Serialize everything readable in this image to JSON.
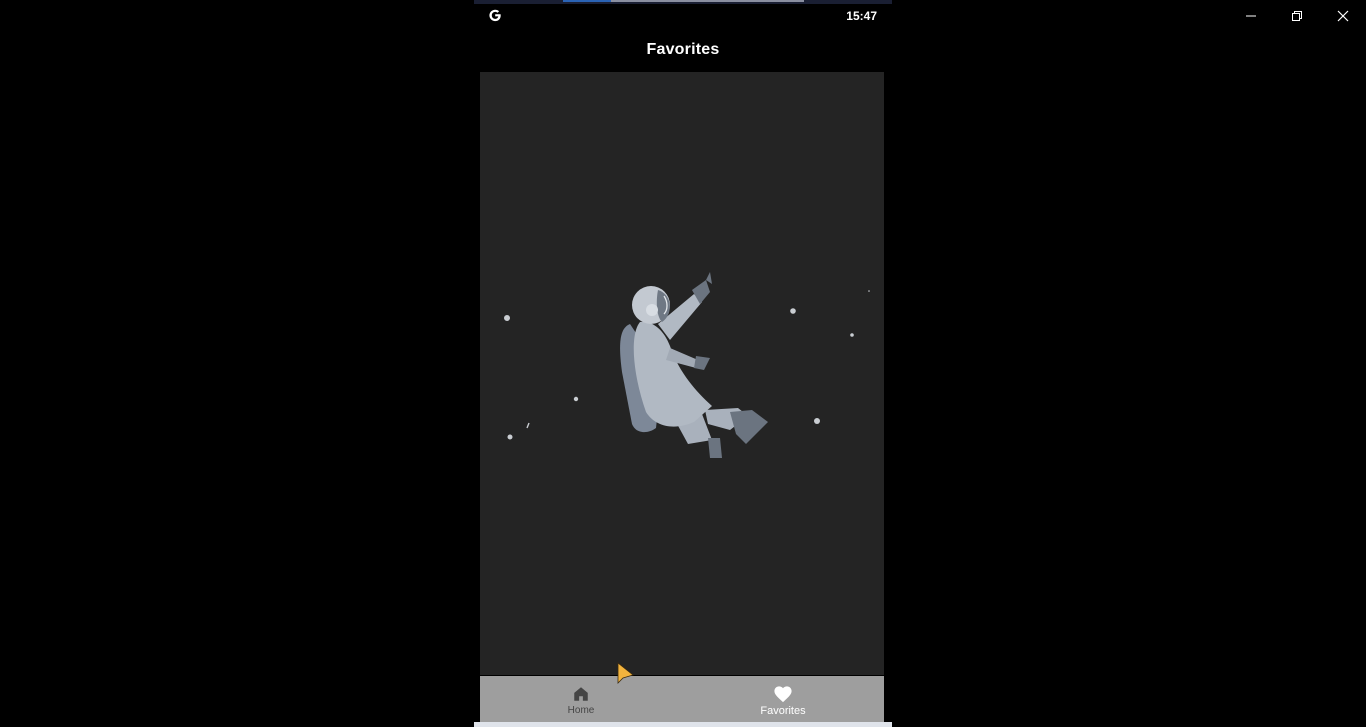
{
  "status": {
    "time": "15:47",
    "app_icon": "google-g-icon"
  },
  "app_bar": {
    "title": "Favorites"
  },
  "illustration": {
    "subject": "floating-astronaut-icon"
  },
  "bottom_nav": {
    "items": [
      {
        "label": "Home",
        "icon": "home-icon",
        "active": false
      },
      {
        "label": "Favorites",
        "icon": "heart-icon",
        "active": true
      }
    ]
  },
  "window_controls": {
    "minimize": "minimize-icon",
    "restore": "restore-icon",
    "close": "close-icon"
  },
  "colors": {
    "background": "#000000",
    "content": "#242424",
    "nav_bar": "#9e9e9e",
    "active_label": "#ffffff",
    "inactive_label": "#454545"
  }
}
